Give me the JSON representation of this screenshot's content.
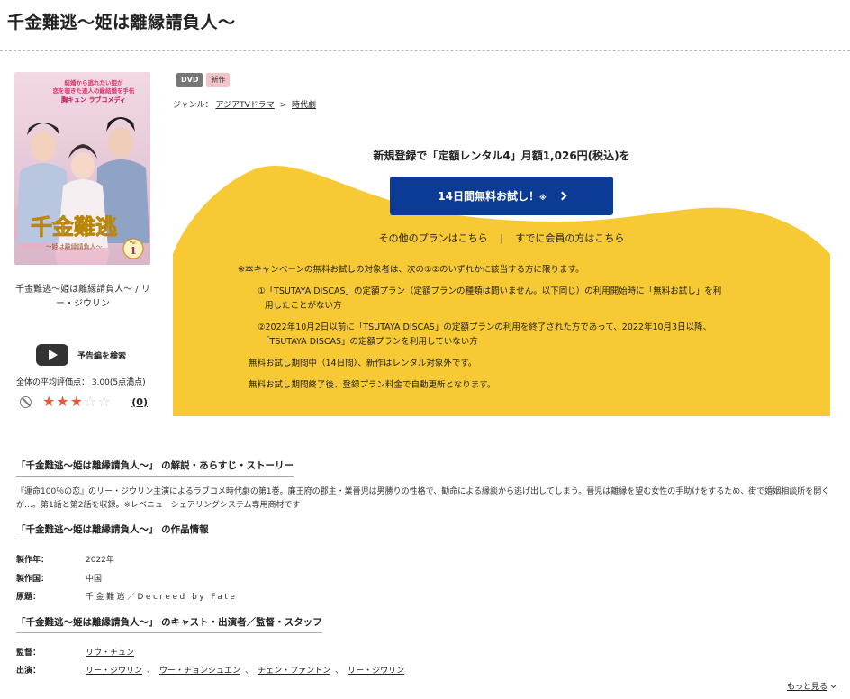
{
  "page": {
    "title": "千金難逃〜姫は離縁請負人〜"
  },
  "cover": {
    "tagline_1": "結婚から逃れたい姫が",
    "tagline_2": "恋を覗きた達人の縁結婚を手伝",
    "tagline_3": "胸キュン ラブコメディ",
    "title_main": "千金難逃",
    "title_sub": "〜姫は離縁請負人〜",
    "vol_label": "Vol.",
    "vol_number": "1",
    "caption": "千金難逃〜姫は離縁請負人〜 / リー・ジウリン"
  },
  "trailer": {
    "label": "予告編を検索",
    "icon": "play-icon"
  },
  "rating": {
    "text": "全体の平均評価点： 3.00(5点満点)",
    "value": 3,
    "max": 5,
    "count": "(0)",
    "star_color": "#e25d3c"
  },
  "badges": {
    "dvd": "DVD",
    "new": "新作"
  },
  "genre": {
    "label": "ジャンル：",
    "items": [
      "アジアTVドラマ",
      "時代劇"
    ],
    "separator": ">"
  },
  "promo": {
    "bg_color": "#f7c934",
    "headline": "新規登録で「定額レンタル4」月額1,026円(税込)を",
    "button_label": "14日間無料お試し！",
    "button_mark": "※",
    "button_color": "#0b3b94",
    "other_plans": "その他のプランはこちら",
    "link_divider": "|",
    "members": "すでに会員の方はこちら",
    "notes": {
      "intro": "※本キャンペーンの無料お試しの対象者は、次の①②のいずれかに該当する方に限ります。",
      "item1_line1": "①「TSUTAYA DISCAS」の定額プラン（定額プランの種類は問いません。以下同じ）の利用開始時に「無料お試し」を利",
      "item1_line2": "用したことがない方",
      "item2_line1": "②2022年10月2日以前に「TSUTAYA DISCAS」の定額プランの利用を終了された方であって、2022年10月3日以降、",
      "item2_line2": "「TSUTAYA DISCAS」の定額プランを利用していない方",
      "trial_note": "無料お試し期間中（14日間）、新作はレンタル対象外です。",
      "renew_note": "無料お試し期間終了後、登録プラン料金で自動更新となります。"
    }
  },
  "story": {
    "heading": "「千金難逃〜姫は離縁請負人〜」 の解説・あらすじ・ストーリー",
    "text": "『運命100％の恋』のリー・ジウリン主演によるラブコメ時代劇の第1巻。廉王府の郡主・業晉児は男勝りの性格で、勧命による縁談から逃げ出してしまう。晉児は離縁を望む女性の手助けをするため、街で婚姻相談所を開くが…。第1話と第2話を収録。※レベニューシェアリングシステム専用商材です"
  },
  "info": {
    "heading": "「千金難逃〜姫は離縁請負人〜」 の作品情報",
    "year_label": "製作年：",
    "year": "2022年",
    "country_label": "製作国：",
    "country": "中国",
    "original_label": "原題：",
    "original": "千金難逃／Decreed by Fate"
  },
  "cast": {
    "heading": "「千金難逃〜姫は離縁請負人〜」 のキャスト・出演者／監督・スタッフ",
    "director_label": "監督：",
    "director": "リウ・チュン",
    "actors_label": "出演：",
    "actors": [
      "リー・ジウリン",
      "ウー・チョンシュエン",
      "チェン・ファントン",
      "リー・ジウリン"
    ],
    "more": "もっと見る"
  }
}
